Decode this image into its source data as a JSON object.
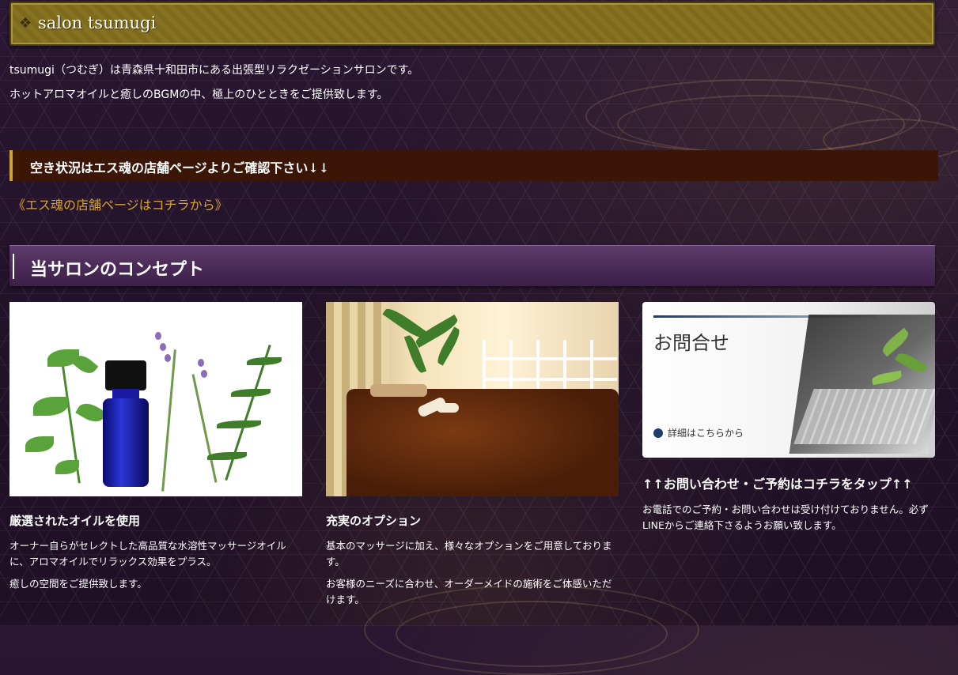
{
  "header": {
    "title": "salon tsumugi"
  },
  "intro": {
    "line1": "tsumugi（つむぎ）は青森県十和田市にある出張型リラクゼーションサロンです。",
    "line2": "ホットアロマオイルと癒しのBGMの中、極上のひとときをご提供致します。"
  },
  "availability": {
    "heading": "空き状況はエス魂の店舗ページよりご確認下さい↓↓"
  },
  "shop_link": {
    "label": "《エス魂の店舗ページはコチラから》"
  },
  "concept": {
    "heading": "当サロンのコンセプト"
  },
  "cards": [
    {
      "title": "厳選されたオイルを使用",
      "p1": "オーナー自らがセレクトした高品質な水溶性マッサージオイルに、アロマオイルでリラックス効果をプラス。",
      "p2": "癒しの空間をご提供致します。"
    },
    {
      "title": "充実のオプション",
      "p1": "基本のマッサージに加え、様々なオプションをご用意しております。",
      "p2": "お客様のニーズに合わせ、オーダーメイドの施術をご体感いただけます。"
    },
    {
      "banner_title": "お問合せ",
      "banner_link": "詳細はこちらから",
      "title": "↑↑お問い合わせ・ご予約はコチラをタップ↑↑",
      "p1": "お電話でのご予約・お問い合わせは受け付けておりません。必ずLINEからご連絡下さるようお願い致します。"
    }
  ],
  "colors": {
    "link": "#d8a52a",
    "header_gold": "#7d6a1c",
    "avail_bar": "#3b1607",
    "concept_bar": "#4a2a57",
    "background": "#241329"
  }
}
